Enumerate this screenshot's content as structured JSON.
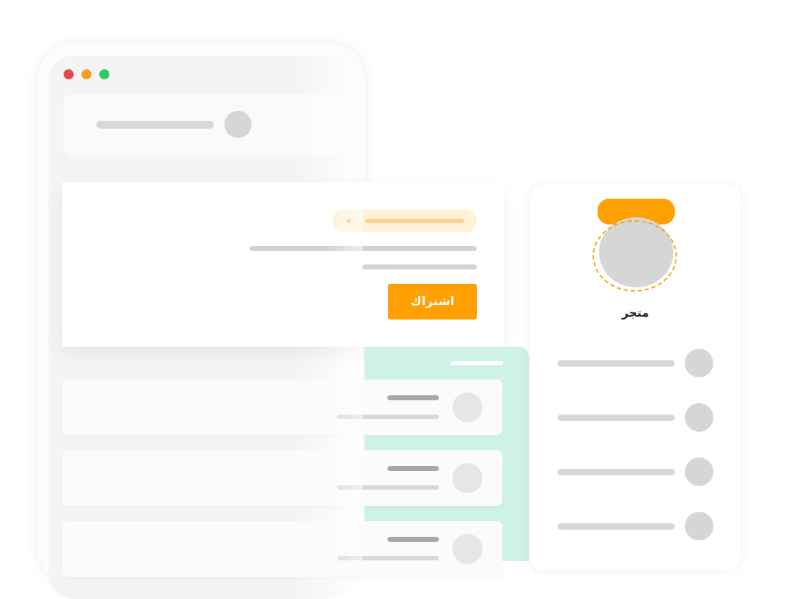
{
  "browser": {
    "window_controls": [
      "close",
      "minimize",
      "maximize"
    ],
    "colors": {
      "close": "#e5474d",
      "minimize": "#f5a11d",
      "maximize": "#2fcb61"
    }
  },
  "hero": {
    "subscribe_label": "اشتراك",
    "accent_color": "#ff9f00"
  },
  "list": {
    "items": [
      {
        "id": 1
      },
      {
        "id": 2
      },
      {
        "id": 3
      }
    ],
    "panel_color": "#cff2e6"
  },
  "profile": {
    "name": "متجر",
    "menu_items": 4
  },
  "icons": [
    "avatar",
    "circle-icon"
  ]
}
